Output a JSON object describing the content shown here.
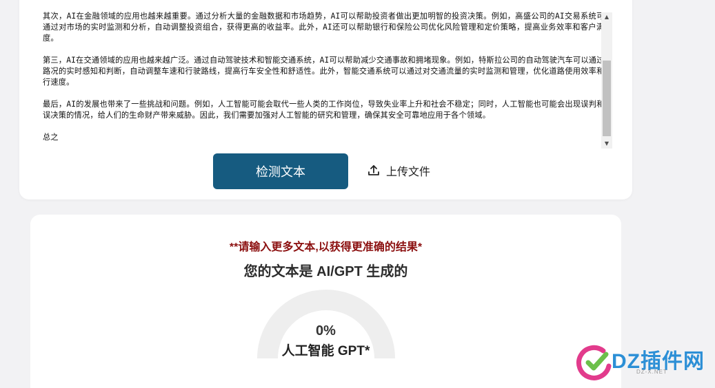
{
  "editor": {
    "paragraphs": [
      "其次，AI在金融领域的应用也越来越重要。通过分析大量的金融数据和市场趋势，AI可以帮助投资者做出更加明智的投资决策。例如，高盛公司的AI交易系统可以通过对市场的实时监测和分析，自动调整投资组合，获得更高的收益率。此外，AI还可以帮助银行和保险公司优化风险管理和定价策略，提高业务效率和客户满意度。",
      "第三，AI在交通领域的应用也越来越广泛。通过自动驾驶技术和智能交通系统，AI可以帮助减少交通事故和拥堵现象。例如，特斯拉公司的自动驾驶汽车可以通过对路况的实时感知和判断，自动调整车速和行驶路线，提高行车安全性和舒适性。此外，智能交通系统可以通过对交通流量的实时监测和管理，优化道路使用效率和通行速度。",
      "最后，AI的发展也带来了一些挑战和问题。例如，人工智能可能会取代一些人类的工作岗位，导致失业率上升和社会不稳定；同时，人工智能也可能会出现误判和错误决策的情况，给人们的生命财产带来威胁。因此，我们需要加强对人工智能的研究和管理，确保其安全可靠地应用于各个领域。",
      "总之"
    ]
  },
  "actions": {
    "detect_label": "检测文本",
    "upload_label": "上传文件"
  },
  "result": {
    "warning": "**请输入更多文本,以获得更准确的结果*",
    "title": "您的文本是 AI/GPT 生成的",
    "gauge_value": "0%",
    "gauge_fraction": 0,
    "gauge_label": "人工智能 GPT*",
    "gauge_track_color": "#eeeeee",
    "gauge_fill_color": "#165b80"
  },
  "watermark": {
    "brand": "DZ插件网",
    "url": "DZ-X.NET"
  },
  "colors": {
    "primary": "#165b80",
    "warning": "#8b0f0f"
  }
}
